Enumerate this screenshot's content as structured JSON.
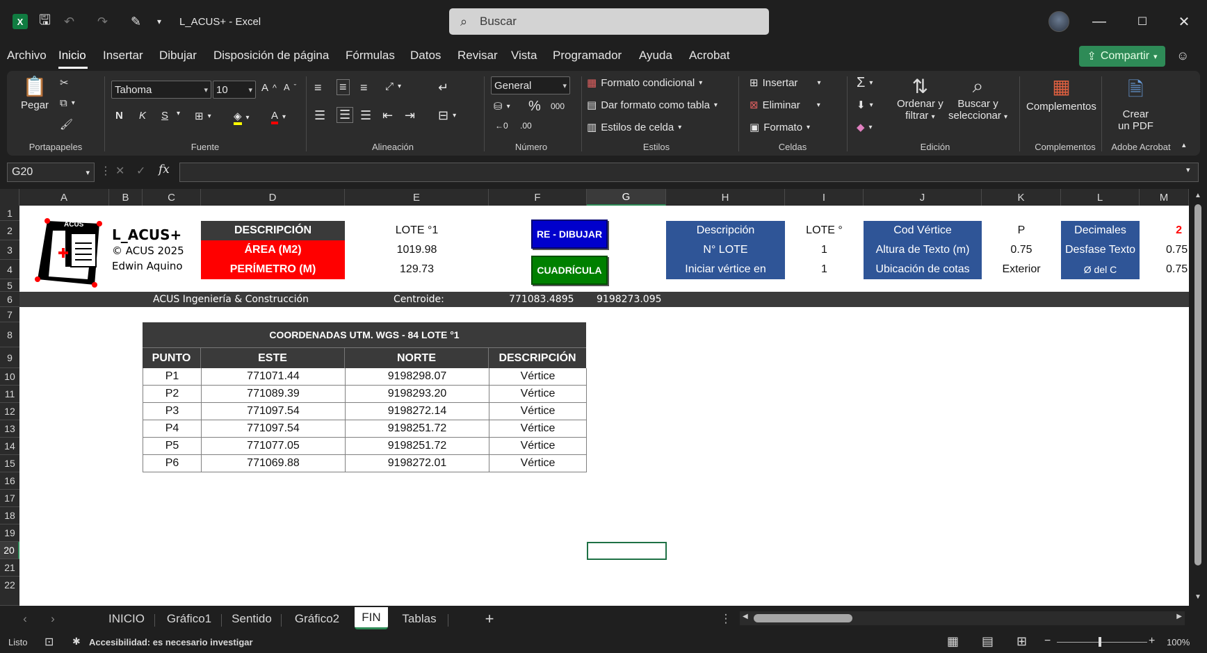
{
  "titlebar": {
    "file_title": "L_ACUS+  -  Excel",
    "search_placeholder": "Buscar"
  },
  "menu": {
    "items": [
      "Archivo",
      "Inicio",
      "Insertar",
      "Dibujar",
      "Disposición de página",
      "Fórmulas",
      "Datos",
      "Revisar",
      "Vista",
      "Programador",
      "Ayuda",
      "Acrobat"
    ],
    "active": "Inicio",
    "share_label": "Compartir"
  },
  "ribbon": {
    "portapapeles": {
      "paste": "Pegar",
      "label": "Portapapeles"
    },
    "fuente": {
      "font": "Tahoma",
      "size": "10",
      "label": "Fuente",
      "bold": "N",
      "italic": "K",
      "underline": "S"
    },
    "alineacion": {
      "label": "Alineación"
    },
    "numero": {
      "format": "General",
      "label": "Número",
      "percent": "%",
      "thousands": "000"
    },
    "estilos": {
      "cond": "Formato condicional",
      "table": "Dar formato como tabla",
      "cell": "Estilos de celda",
      "label": "Estilos"
    },
    "celdas": {
      "insert": "Insertar",
      "delete": "Eliminar",
      "format": "Formato",
      "label": "Celdas"
    },
    "edicion": {
      "sort1": "Ordenar y",
      "sort2": "filtrar",
      "find1": "Buscar y",
      "find2": "seleccionar",
      "label": "Edición"
    },
    "complementos": {
      "btn": "Complementos",
      "label": "Complementos"
    },
    "acrobat": {
      "btn1": "Crear",
      "btn2": "un PDF",
      "label": "Adobe Acrobat"
    }
  },
  "formula_bar": {
    "name_box": "G20",
    "formula": ""
  },
  "columns": [
    "A",
    "B",
    "C",
    "D",
    "E",
    "F",
    "G",
    "H",
    "I",
    "J",
    "K",
    "L",
    "M"
  ],
  "rows": [
    "1",
    "2",
    "3",
    "4",
    "5",
    "6",
    "7",
    "8",
    "9",
    "10",
    "11",
    "12",
    "13",
    "14",
    "15",
    "16",
    "17",
    "18",
    "19",
    "20",
    "21",
    "22"
  ],
  "logo": {
    "badge": "ACUS",
    "title": "L_ACUS+",
    "copyright": "© ACUS 2025",
    "author": "Edwin Aquino"
  },
  "summary": {
    "desc_label": "DESCRIPCIÓN",
    "desc_value": "LOTE °1",
    "area_label": "ÁREA (M2)",
    "area_value": "1019.98",
    "perim_label": "PERÍMETRO (M)",
    "perim_value": "129.73"
  },
  "buttons": {
    "redraw": "RE - DIBUJAR",
    "grid": "CUADRÍCULA"
  },
  "settings": {
    "h2": "Descripción",
    "i2": "LOTE °",
    "j2": "Cod Vértice",
    "k2": "P",
    "l2": "Decimales",
    "m2": "2",
    "h3": "N° LOTE",
    "i3": "1",
    "j3": "Altura de Texto (m)",
    "k3": "0.75",
    "l3": "Desfase Texto",
    "m3": "0.75",
    "h4": "Iniciar vértice en",
    "i4": "1",
    "j4": "Ubicación de cotas",
    "k4": "Exterior",
    "l4": "Ø del C",
    "m4": "0.75"
  },
  "band": {
    "company": "ACUS Ingeniería & Construcción",
    "centroid_label": "Centroide:",
    "cx": "771083.4895",
    "cy": "9198273.095"
  },
  "coords": {
    "title": "COORDENADAS UTM. WGS - 84  LOTE °1",
    "headers": [
      "PUNTO",
      "ESTE",
      "NORTE",
      "DESCRIPCIÓN"
    ],
    "rows": [
      [
        "P1",
        "771071.44",
        "9198298.07",
        "Vértice"
      ],
      [
        "P2",
        "771089.39",
        "9198293.20",
        "Vértice"
      ],
      [
        "P3",
        "771097.54",
        "9198272.14",
        "Vértice"
      ],
      [
        "P4",
        "771097.54",
        "9198251.72",
        "Vértice"
      ],
      [
        "P5",
        "771077.05",
        "9198251.72",
        "Vértice"
      ],
      [
        "P6",
        "771069.88",
        "9198272.01",
        "Vértice"
      ]
    ]
  },
  "tabs": [
    "INICIO",
    "Gráfico1",
    "Sentido",
    "Gráfico2",
    "FIN",
    "Tablas"
  ],
  "active_tab": "FIN",
  "status": {
    "ready": "Listo",
    "accessibility": "Accesibilidad: es necesario investigar",
    "zoom": "100%"
  }
}
